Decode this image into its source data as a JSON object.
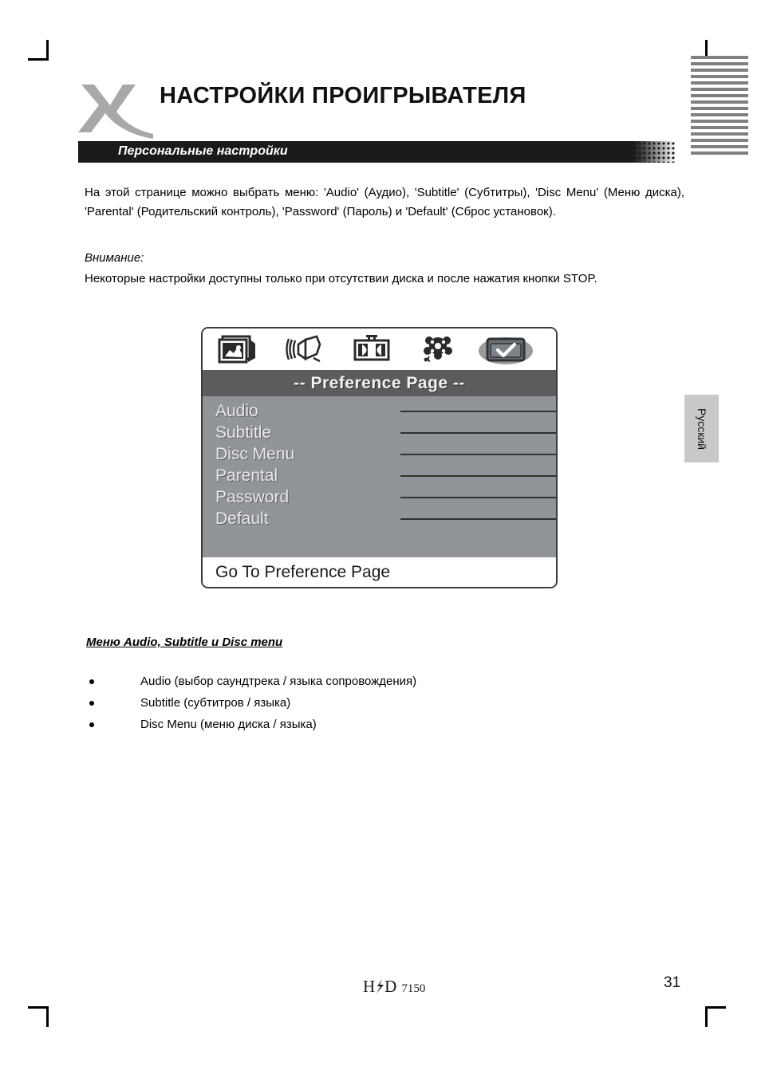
{
  "header": {
    "title": "НАСТРОЙКИ ПРОИГРЫВАТЕЛЯ",
    "logo_name": "x-swoosh-logo",
    "subtitle": "Персональные настройки"
  },
  "content": {
    "intro_paragraph": "На этой странице можно выбрать меню: 'Audio' (Аудио), 'Subtitle' (Субтитры), 'Disc Menu' (Меню диска), 'Parental' (Родительский контроль), 'Password' (Пароль) и 'Default' (Сброс установок).",
    "notice_label": "Внимание:",
    "notice_paragraph": "Некоторые настройки доступны только при отсутствии диска и после нажатия кнопки STOP.",
    "section_heading": "Меню Audio, Subtitle и Disc menu",
    "bullets": [
      "Audio (выбор саундтрека / языка сопровождения)",
      "Subtitle (субтитров / языка)",
      "Disc Menu (меню диска / языка)"
    ]
  },
  "osd": {
    "title": "-- Preference Page --",
    "footer": "Go To Preference Page",
    "icons": [
      {
        "name": "general-setup-icon",
        "selected": false
      },
      {
        "name": "audio-setup-icon",
        "selected": false
      },
      {
        "name": "video-setup-icon",
        "selected": false
      },
      {
        "name": "dolby-digital-setup-icon",
        "selected": false
      },
      {
        "name": "preference-page-icon",
        "selected": true
      }
    ],
    "menu_items": [
      {
        "label": "Audio"
      },
      {
        "label": "Subtitle"
      },
      {
        "label": "Disc Menu"
      },
      {
        "label": "Parental"
      },
      {
        "label": "Password"
      },
      {
        "label": "Default"
      }
    ],
    "colors": {
      "titlebar": "#5c5c5c",
      "body": "#919499",
      "text": "#e9e9ea",
      "footer_bg": "#ffffff"
    }
  },
  "side_tab": {
    "label": "Русский"
  },
  "footer": {
    "logo_main": "HD",
    "logo_model": "7150",
    "page_number": "31"
  }
}
